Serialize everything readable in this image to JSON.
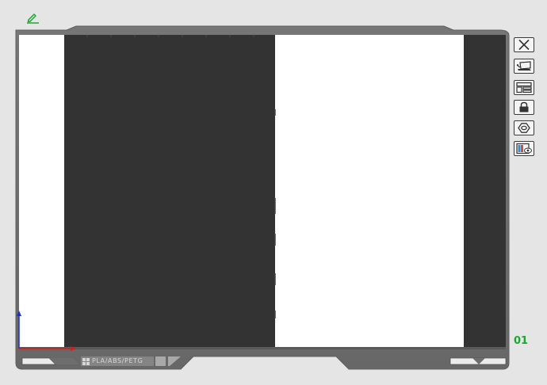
{
  "plate": {
    "number": "01",
    "filament_type": "PLA/ABS/PETG"
  },
  "toolbar": {
    "buttons": [
      {
        "name": "close-plate-button",
        "icon": "close-icon"
      },
      {
        "name": "auto-orient-button",
        "icon": "orient-icon"
      },
      {
        "name": "arrange-button",
        "icon": "arrange-icon"
      },
      {
        "name": "lock-plate-button",
        "icon": "lock-icon"
      },
      {
        "name": "plate-settings-button",
        "icon": "hexagon-icon"
      },
      {
        "name": "plate-preview-button",
        "icon": "preview-eye-icon"
      }
    ]
  },
  "colors": {
    "background": "#e5e5e5",
    "frame": "#6e6e6e",
    "bed_dark": "#333333",
    "bed_light": "#ffffff",
    "accent_green": "#1aa830",
    "axis_x": "#cc1f1f",
    "axis_y": "#1f2fcc"
  }
}
